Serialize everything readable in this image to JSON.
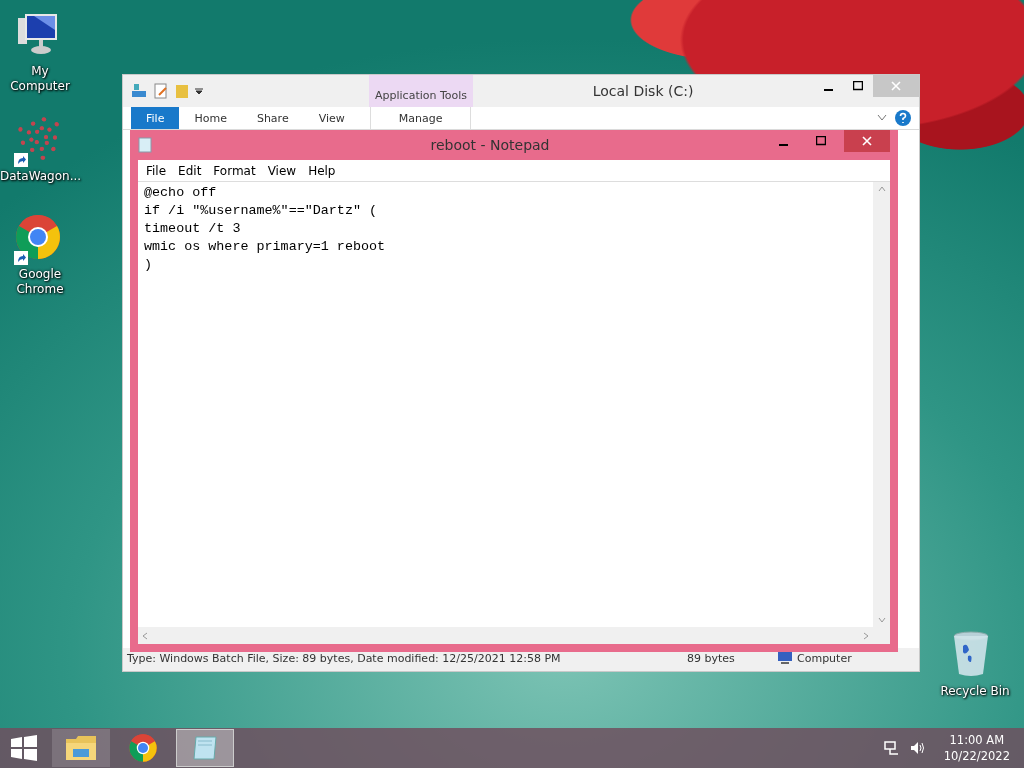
{
  "desktop_icons": [
    {
      "label": "My Computer",
      "kind": "computer",
      "shortcut": false
    },
    {
      "label": "DataWagon...",
      "kind": "dots",
      "shortcut": true
    },
    {
      "label": "Google Chrome",
      "kind": "chrome",
      "shortcut": true
    },
    {
      "label": "Recycle Bin",
      "kind": "bin",
      "shortcut": false
    }
  ],
  "explorer": {
    "title": "Local Disk (C:)",
    "context_group": "Application Tools",
    "ribbon_tabs": [
      {
        "label": "File",
        "kind": "file",
        "selected": false
      },
      {
        "label": "Home",
        "kind": "tab",
        "selected": false
      },
      {
        "label": "Share",
        "kind": "tab",
        "selected": false
      },
      {
        "label": "View",
        "kind": "tab",
        "selected": false
      },
      {
        "label": "Manage",
        "kind": "context",
        "selected": false
      }
    ],
    "status_bar": [
      "Type: Windows Batch File, Size: 89 bytes, Date modified: 12/25/2021 12:58 PM",
      "89 bytes",
      "Computer"
    ]
  },
  "notepad": {
    "title": "reboot - Notepad",
    "menu": [
      "File",
      "Edit",
      "Format",
      "View",
      "Help"
    ],
    "lines": [
      "@echo off",
      "if /i \"%username%\"==\"Dartz\" (",
      "timeout /t 3",
      "wmic os where primary=1 reboot",
      ")"
    ]
  },
  "taskbar": {
    "apps": [
      {
        "kind": "explorer",
        "selected": false
      },
      {
        "kind": "chrome",
        "selected": false
      },
      {
        "kind": "notepad",
        "selected": true
      }
    ],
    "time": "11:00 AM",
    "date": "10/22/2022"
  }
}
